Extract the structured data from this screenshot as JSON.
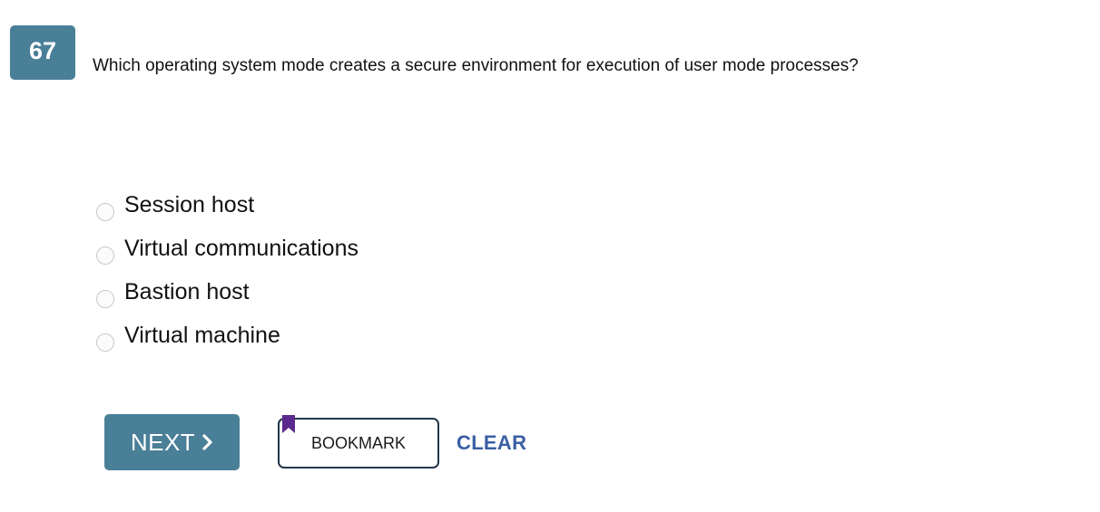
{
  "question": {
    "number": "67",
    "text": "Which operating system mode creates a secure environment for execution of user mode processes?"
  },
  "options": [
    {
      "label": "Session host",
      "selected": false
    },
    {
      "label": "Virtual communications",
      "selected": false
    },
    {
      "label": "Bastion host",
      "selected": false
    },
    {
      "label": "Virtual machine",
      "selected": false
    }
  ],
  "actions": {
    "next_label": "NEXT",
    "next_icon": "chevron-right-icon",
    "bookmark_label": "BOOKMARK",
    "bookmark_icon": "bookmark-flag-icon",
    "clear_label": "CLEAR"
  },
  "colors": {
    "accent": "#4a7f98",
    "link": "#3b5ea3",
    "bookmark_flag": "#5b2a8c"
  }
}
